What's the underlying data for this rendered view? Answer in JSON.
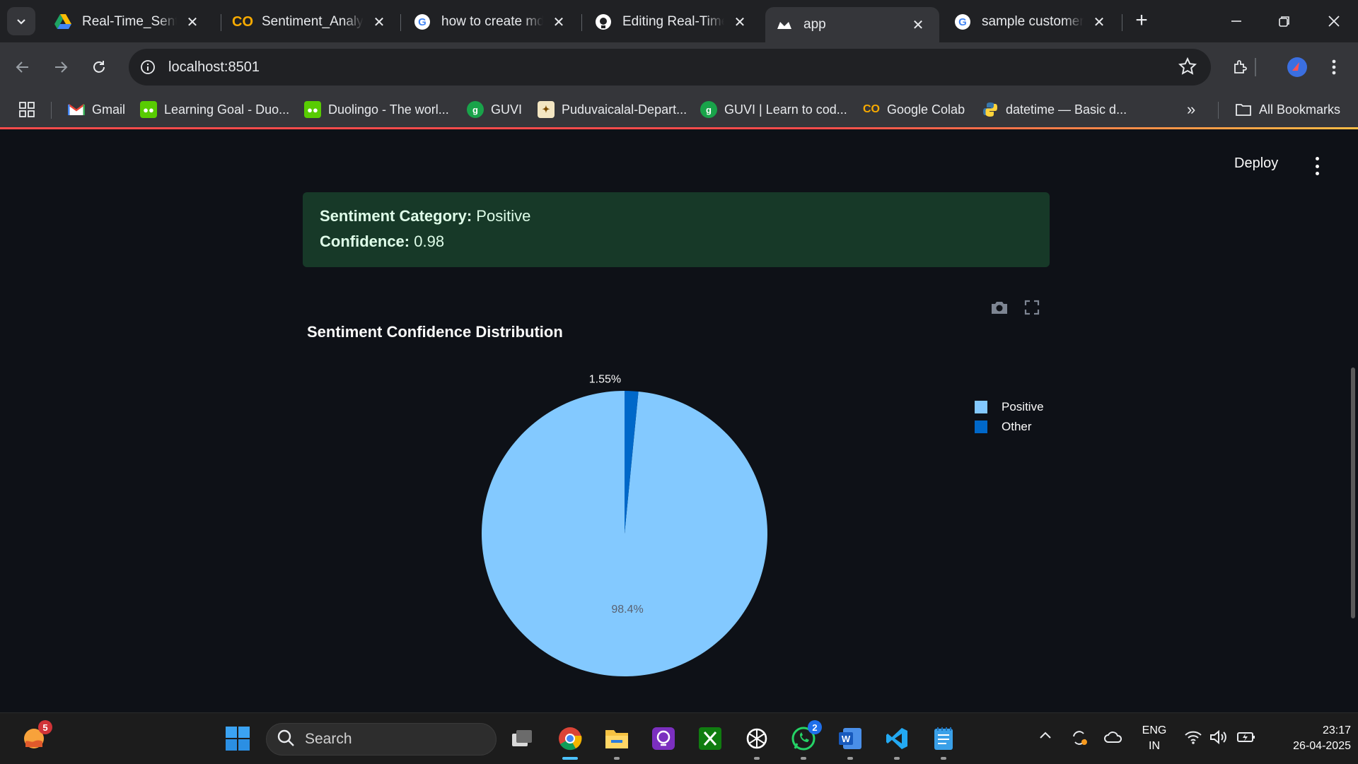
{
  "browser": {
    "tabs": [
      {
        "title": "Real-Time_Sentiment",
        "icon": "google-drive-icon"
      },
      {
        "title": "Sentiment_Analysis",
        "icon": "colab-icon"
      },
      {
        "title": "how to create md file",
        "icon": "google-icon"
      },
      {
        "title": "Editing Real-Time-",
        "icon": "github-icon"
      },
      {
        "title": "app",
        "icon": "streamlit-icon",
        "active": true
      },
      {
        "title": "sample customer feedback",
        "icon": "google-icon"
      }
    ],
    "url": "localhost:8501",
    "bookmarks": [
      {
        "label": "Gmail",
        "icon": "gmail-icon"
      },
      {
        "label": "Learning Goal - Duo...",
        "icon": "duolingo-icon"
      },
      {
        "label": "Duolingo - The worl...",
        "icon": "duolingo-icon"
      },
      {
        "label": "GUVI",
        "icon": "guvi-icon"
      },
      {
        "label": "Puduvaicalal-Depart...",
        "icon": "emblem-icon"
      },
      {
        "label": "GUVI | Learn to cod...",
        "icon": "guvi-icon"
      },
      {
        "label": "Google Colab",
        "icon": "colab-icon"
      },
      {
        "label": "datetime — Basic d...",
        "icon": "python-icon"
      }
    ],
    "all_bookmarks_label": "All Bookmarks"
  },
  "app": {
    "deploy_label": "Deploy",
    "result": {
      "category_label": "Sentiment Category:",
      "category_value": "Positive",
      "confidence_label": "Confidence:",
      "confidence_value": "0.98"
    }
  },
  "chart_data": {
    "type": "pie",
    "title": "Sentiment Confidence Distribution",
    "labels": [
      "Positive",
      "Other"
    ],
    "values": [
      98.4,
      1.55
    ],
    "text_labels": [
      "98.4%",
      "1.55%"
    ],
    "colors": [
      "#83c9ff",
      "#0068c9"
    ],
    "legend_position": "top-right"
  },
  "taskbar": {
    "search_placeholder": "Search",
    "notification_badge": "5",
    "whatsapp_badge": "2",
    "language": "ENG",
    "region": "IN",
    "time": "23:17",
    "date": "26-04-2025"
  }
}
